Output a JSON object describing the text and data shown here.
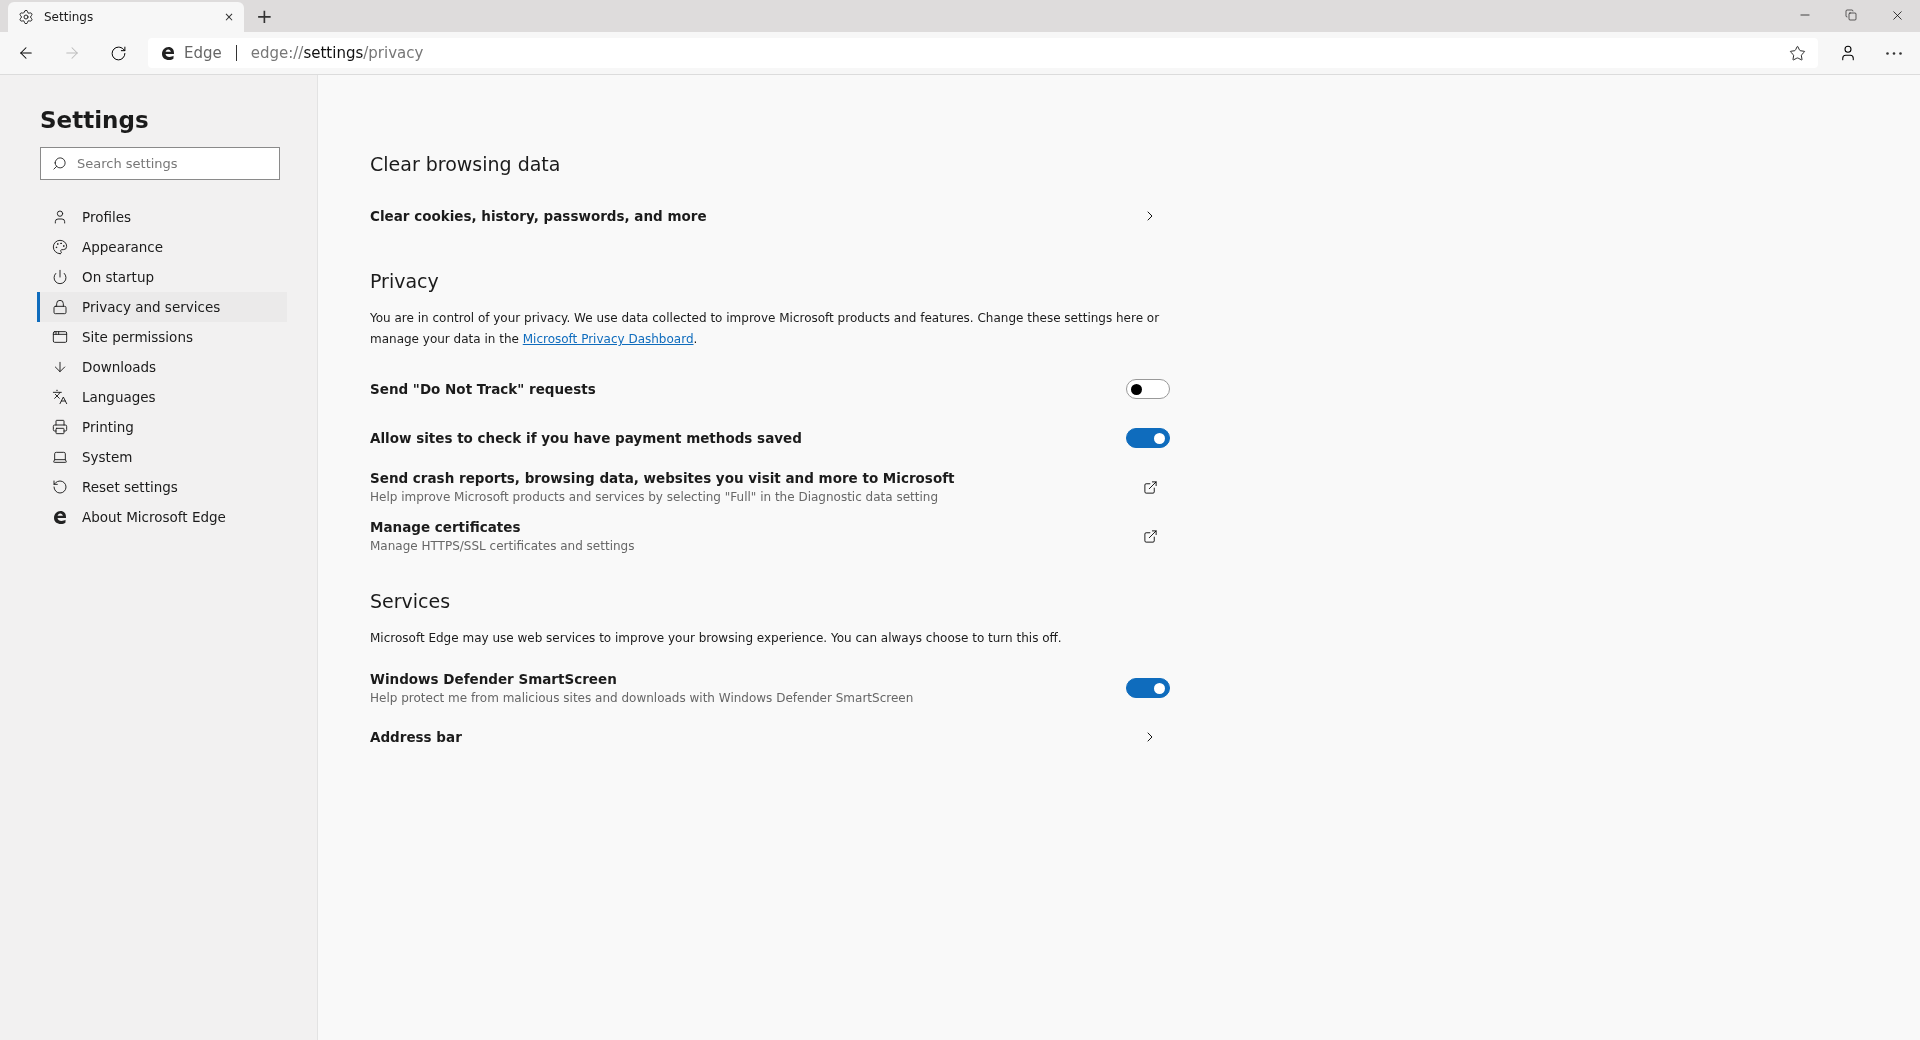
{
  "tab": {
    "title": "Settings",
    "close": "×",
    "new_tab": "+"
  },
  "address_bar": {
    "badge": "Edge",
    "url_prefix": "edge://",
    "url_host": "settings",
    "url_path": "/privacy"
  },
  "sidebar": {
    "title": "Settings",
    "search": {
      "placeholder": "Search settings"
    },
    "items": [
      {
        "label": "Profiles",
        "selected": false
      },
      {
        "label": "Appearance",
        "selected": false
      },
      {
        "label": "On startup",
        "selected": false
      },
      {
        "label": "Privacy and services",
        "selected": true
      },
      {
        "label": "Site permissions",
        "selected": false
      },
      {
        "label": "Downloads",
        "selected": false
      },
      {
        "label": "Languages",
        "selected": false
      },
      {
        "label": "Printing",
        "selected": false
      },
      {
        "label": "System",
        "selected": false
      },
      {
        "label": "Reset settings",
        "selected": false
      },
      {
        "label": "About Microsoft Edge",
        "selected": false
      }
    ]
  },
  "sections": [
    {
      "title": "Clear browsing data",
      "rows": [
        {
          "kind": "link",
          "label": "Clear cookies, history, passwords, and more"
        }
      ]
    },
    {
      "title": "Privacy",
      "description": {
        "before": "You are in control of your privacy. We use data collected to improve Microsoft products and features. Change these settings here or manage your data in the ",
        "link": "Microsoft Privacy Dashboard",
        "after": "."
      },
      "rows": [
        {
          "kind": "toggle",
          "label": "Send \"Do Not Track\" requests",
          "on": false
        },
        {
          "kind": "toggle",
          "label": "Allow sites to check if you have payment methods saved",
          "on": true
        },
        {
          "kind": "external",
          "label": "Send crash reports, browsing data, websites you visit and more to Microsoft",
          "detail": "Help improve Microsoft products and services by selecting \"Full\" in the Diagnostic data setting"
        },
        {
          "kind": "external",
          "label": "Manage certificates",
          "detail": "Manage HTTPS/SSL certificates and settings"
        }
      ]
    },
    {
      "title": "Services",
      "description": {
        "before": "Microsoft Edge may use web services to improve your browsing experience. You can always choose to turn this off."
      },
      "rows": [
        {
          "kind": "toggle",
          "label": "Windows Defender SmartScreen",
          "detail": "Help protect me from malicious sites and downloads with Windows Defender SmartScreen",
          "on": true
        },
        {
          "kind": "link",
          "label": "Address bar"
        }
      ]
    }
  ]
}
